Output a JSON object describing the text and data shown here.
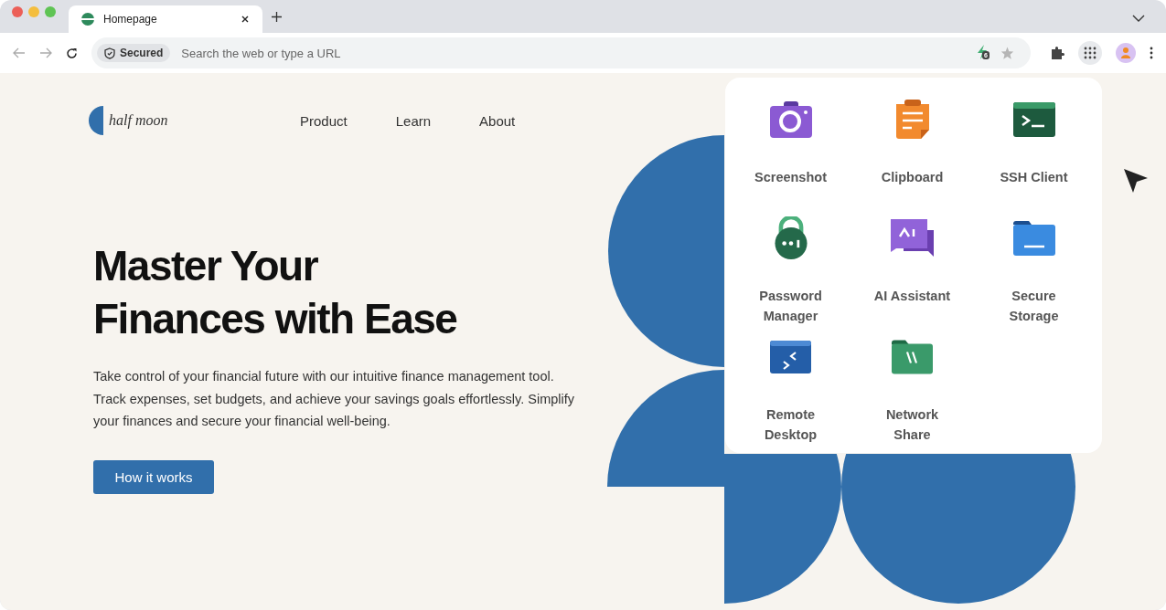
{
  "browser": {
    "tab": {
      "title": "Homepage",
      "selected": true
    },
    "address_bar": {
      "security_label": "Secured",
      "placeholder": "Search the web or type a URL"
    },
    "extension_badge": "6"
  },
  "site": {
    "logo": "half moon",
    "nav": [
      {
        "label": "Product"
      },
      {
        "label": "Learn"
      },
      {
        "label": "About"
      }
    ],
    "hero": {
      "title_lines": [
        "Master Your",
        "Finances with Ease"
      ],
      "text": "Take control of your financial future with our intuitive finance management tool. Track expenses, set budgets, and achieve your savings goals effortlessly. Simplify your finances and secure your financial well-being.",
      "button": "How it works"
    }
  },
  "apps_menu": {
    "apps": [
      {
        "kind": "camera",
        "label_lines": [
          "Screenshot"
        ]
      },
      {
        "kind": "clipboard",
        "label_lines": [
          "Clipboard"
        ]
      },
      {
        "kind": "terminal",
        "label_lines": [
          "SSH Client"
        ]
      },
      {
        "kind": "lock",
        "label_lines": [
          "Password",
          "Manager"
        ]
      },
      {
        "kind": "chat",
        "label_lines": [
          "AI Assistant"
        ]
      },
      {
        "kind": "folder",
        "label_lines": [
          "Secure",
          "Storage"
        ]
      },
      {
        "kind": "remote",
        "label_lines": [
          "Remote",
          "Desktop"
        ]
      },
      {
        "kind": "network",
        "label_lines": [
          "Network",
          "Share"
        ]
      }
    ]
  }
}
